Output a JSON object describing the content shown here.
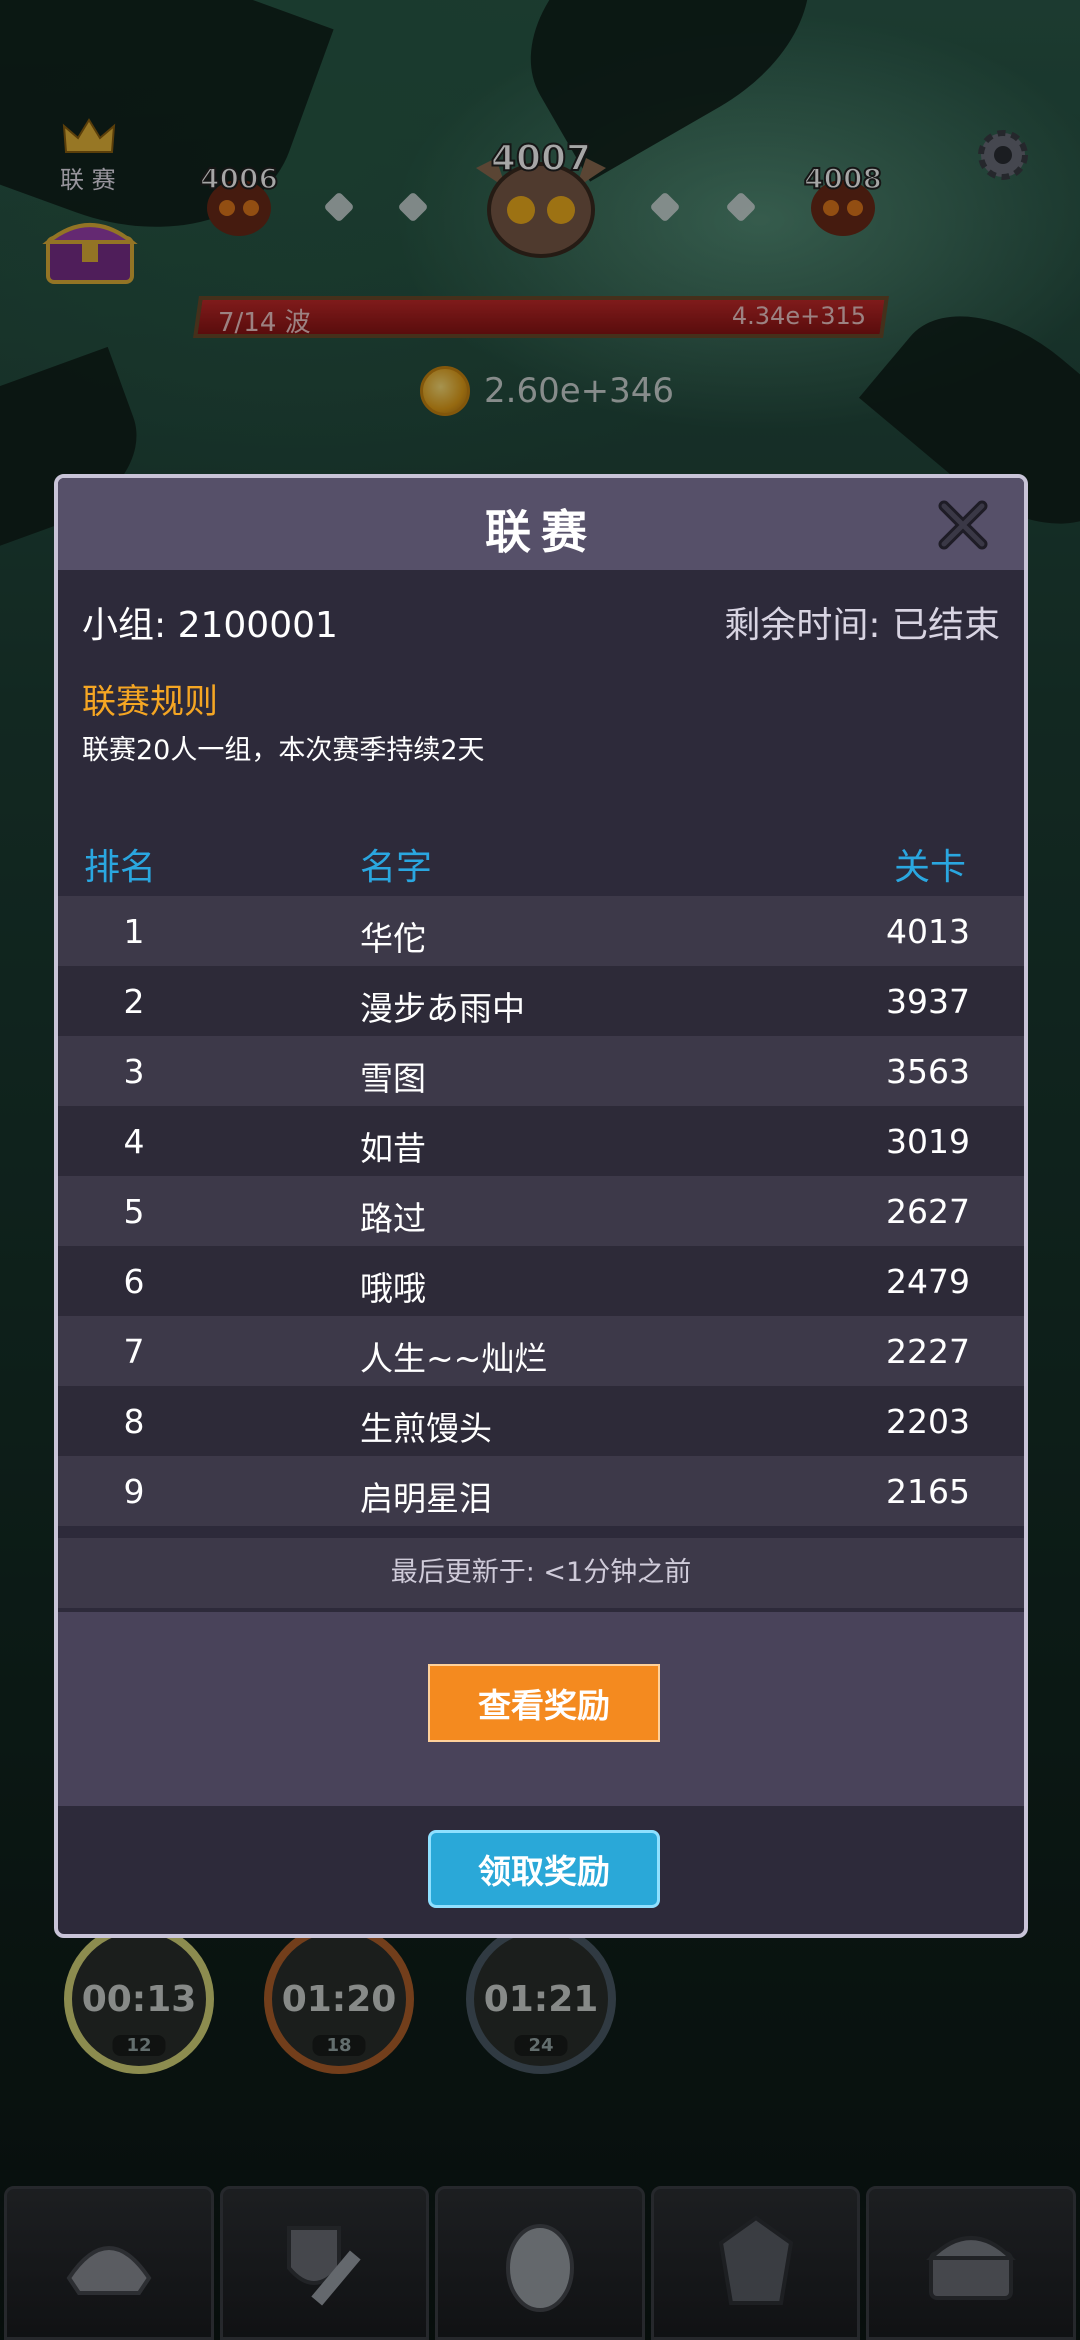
{
  "hud": {
    "league_label": "联 赛",
    "levels": [
      "4006",
      "4007",
      "4008"
    ],
    "wave_text": "7/14 波",
    "boss_hp": "4.34e+315",
    "coins": "2.60e+346"
  },
  "timers": [
    {
      "time": "00:13",
      "sub": "12"
    },
    {
      "time": "01:20",
      "sub": "18"
    },
    {
      "time": "01:21",
      "sub": "24"
    }
  ],
  "modal": {
    "title": "联赛",
    "group": "小组: 2100001",
    "remaining": "剩余时间: 已结束",
    "rules_title": "联赛规则",
    "rules_desc": "联赛20人一组，本次赛季持续2天",
    "columns": {
      "rank": "排名",
      "name": "名字",
      "level": "关卡"
    },
    "rows": [
      {
        "rank": "1",
        "name": "华佗",
        "level": "4013"
      },
      {
        "rank": "2",
        "name": "漫步あ雨中",
        "level": "3937"
      },
      {
        "rank": "3",
        "name": "雪图",
        "level": "3563"
      },
      {
        "rank": "4",
        "name": "如昔",
        "level": "3019"
      },
      {
        "rank": "5",
        "name": "路过",
        "level": "2627"
      },
      {
        "rank": "6",
        "name": "哦哦",
        "level": "2479"
      },
      {
        "rank": "7",
        "name": "人生~~灿烂",
        "level": "2227"
      },
      {
        "rank": "8",
        "name": "生煎馒头",
        "level": "2203"
      },
      {
        "rank": "9",
        "name": "启明星泪",
        "level": "2165"
      }
    ],
    "last_update": "最后更新于: <1分钟之前",
    "view_rewards": "查看奖励",
    "claim_rewards": "领取奖励"
  },
  "colors": {
    "accent_orange": "#f48a1f",
    "accent_blue": "#2aa8d8",
    "header_blue": "#2aa7e0",
    "rules_orange": "#f5a623"
  }
}
